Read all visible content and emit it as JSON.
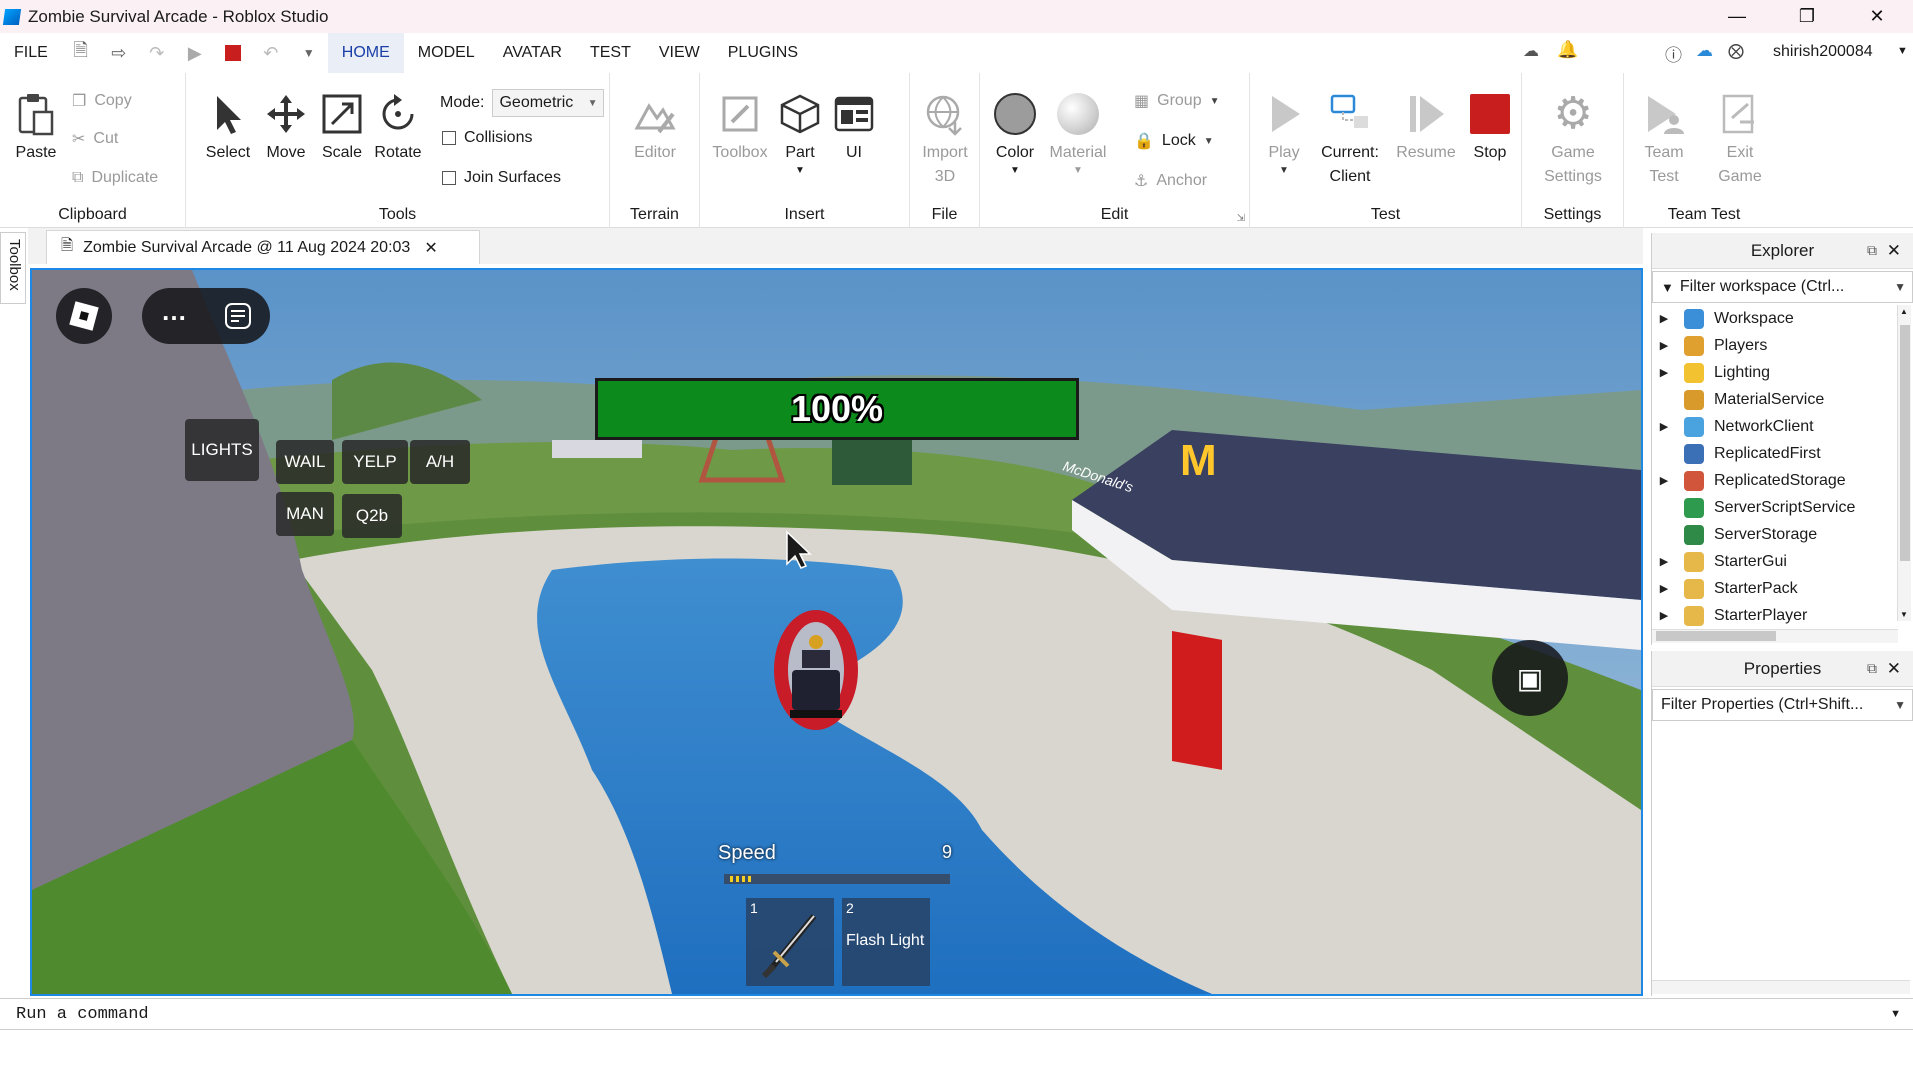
{
  "window": {
    "title": "Zombie Survival Arcade - Roblox Studio"
  },
  "menu": {
    "items": [
      "FILE",
      "HOME",
      "MODEL",
      "AVATAR",
      "TEST",
      "VIEW",
      "PLUGINS"
    ],
    "active": "HOME",
    "username": "shirish200084"
  },
  "ribbon": {
    "clipboard": {
      "label": "Clipboard",
      "paste": "Paste",
      "copy": "Copy",
      "cut": "Cut",
      "duplicate": "Duplicate"
    },
    "tools": {
      "label": "Tools",
      "select": "Select",
      "move": "Move",
      "scale": "Scale",
      "rotate": "Rotate",
      "mode_label": "Mode:",
      "mode_value": "Geometric",
      "collisions": "Collisions",
      "join_surfaces": "Join Surfaces"
    },
    "terrain": {
      "label": "Terrain",
      "editor": "Editor"
    },
    "insert": {
      "label": "Insert",
      "toolbox": "Toolbox",
      "part": "Part",
      "ui": "UI"
    },
    "file": {
      "label": "File",
      "import_line1": "Import",
      "import_line2": "3D"
    },
    "edit": {
      "label": "Edit",
      "color": "Color",
      "material": "Material",
      "group": "Group",
      "lock": "Lock",
      "anchor": "Anchor"
    },
    "test": {
      "label": "Test",
      "play": "Play",
      "current_line1": "Current:",
      "current_line2": "Client",
      "resume": "Resume",
      "stop": "Stop"
    },
    "settings": {
      "label": "Settings",
      "game_line1": "Game",
      "game_line2": "Settings"
    },
    "team_test": {
      "label": "Team Test",
      "team_line1": "Team",
      "team_line2": "Test",
      "exit_line1": "Exit",
      "exit_line2": "Game"
    }
  },
  "toolbox_tab": "Toolbox",
  "document_tab": {
    "title": "Zombie Survival Arcade @ 11 Aug 2024 20:03"
  },
  "game": {
    "health_text": "100%",
    "health": 1.0,
    "siren_buttons": [
      "LIGHTS",
      "WAIL",
      "YELP",
      "A/H",
      "MAN",
      "Q2b"
    ],
    "speed_label": "Speed",
    "speed_value": "9",
    "hotbar": [
      {
        "slot": "1",
        "name": ""
      },
      {
        "slot": "2",
        "name": "Flash Light"
      }
    ],
    "sign_text": "McDonald's"
  },
  "explorer": {
    "title": "Explorer",
    "filter_placeholder": "Filter workspace (Ctrl...",
    "items": [
      {
        "name": "Workspace",
        "expandable": true,
        "color": "#3a8fd8"
      },
      {
        "name": "Players",
        "expandable": true,
        "color": "#e0a030"
      },
      {
        "name": "Lighting",
        "expandable": true,
        "color": "#f2c230"
      },
      {
        "name": "MaterialService",
        "expandable": false,
        "color": "#d89a2a"
      },
      {
        "name": "NetworkClient",
        "expandable": true,
        "color": "#4aa3df"
      },
      {
        "name": "ReplicatedFirst",
        "expandable": false,
        "color": "#3b6fb6"
      },
      {
        "name": "ReplicatedStorage",
        "expandable": true,
        "color": "#d0553a"
      },
      {
        "name": "ServerScriptService",
        "expandable": false,
        "color": "#2e9a4e"
      },
      {
        "name": "ServerStorage",
        "expandable": false,
        "color": "#2e8a46"
      },
      {
        "name": "StarterGui",
        "expandable": true,
        "color": "#e6b84a"
      },
      {
        "name": "StarterPack",
        "expandable": true,
        "color": "#e6b84a"
      },
      {
        "name": "StarterPlayer",
        "expandable": true,
        "color": "#e6b84a"
      }
    ]
  },
  "properties": {
    "title": "Properties",
    "filter_placeholder": "Filter Properties (Ctrl+Shift..."
  },
  "command_bar": {
    "placeholder": "Run a command"
  }
}
